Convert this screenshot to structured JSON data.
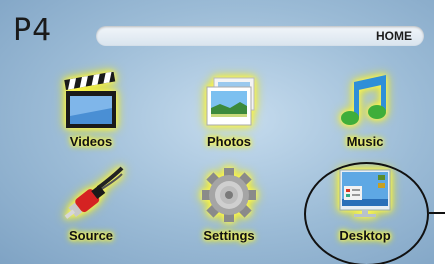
{
  "header": {
    "brand": "P4",
    "home_label": "HOME"
  },
  "tiles": [
    {
      "label": "Videos",
      "icon": "clapperboard-icon"
    },
    {
      "label": "Photos",
      "icon": "photos-icon"
    },
    {
      "label": "Music",
      "icon": "music-note-icon"
    },
    {
      "label": "Source",
      "icon": "rca-cable-icon"
    },
    {
      "label": "Settings",
      "icon": "gear-icon"
    },
    {
      "label": "Desktop",
      "icon": "desktop-icon"
    }
  ],
  "colors": {
    "background": "#9bbbd6",
    "glow": "#f3f000"
  }
}
